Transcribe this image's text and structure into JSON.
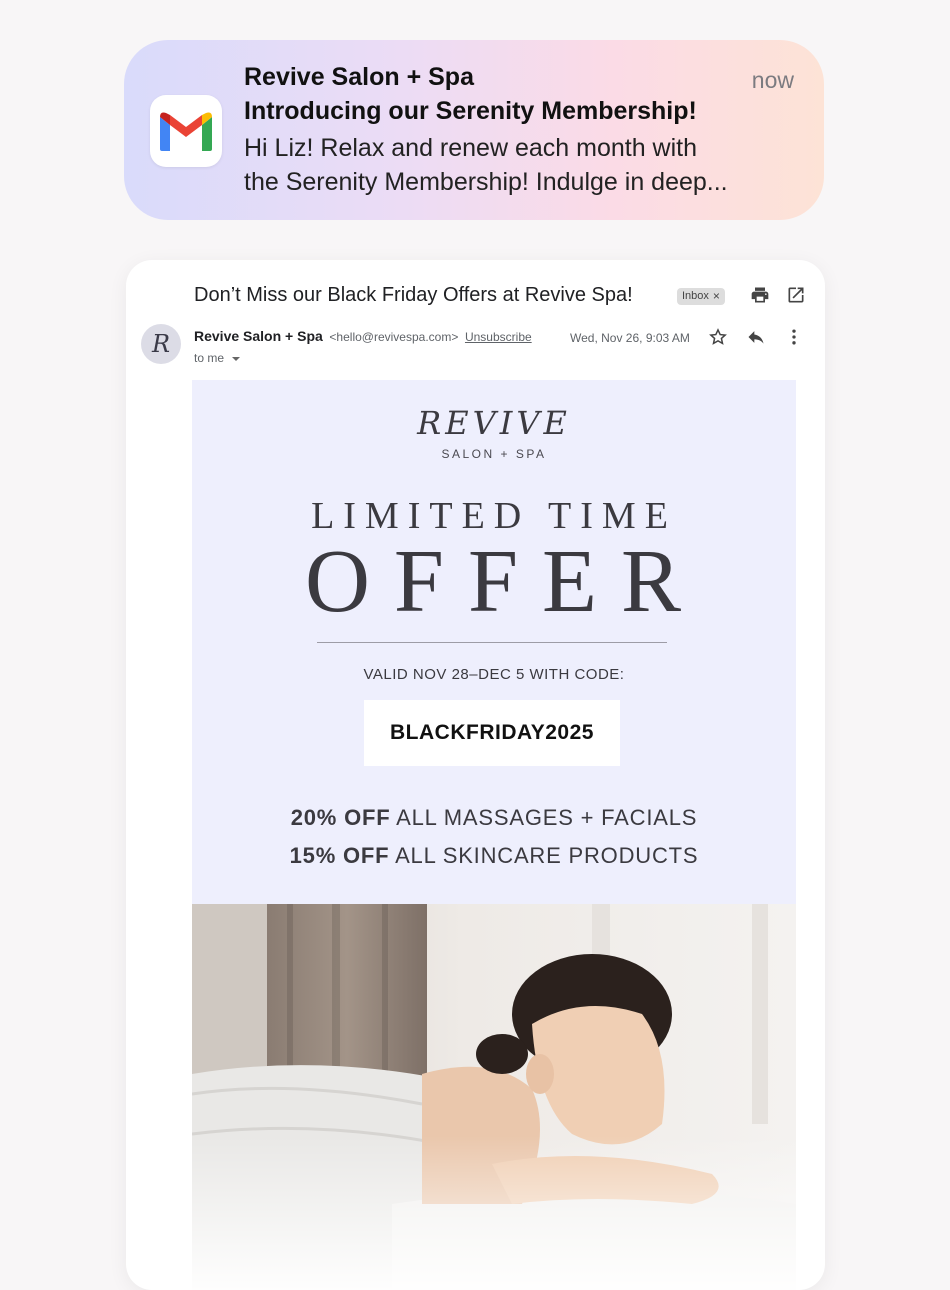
{
  "notification": {
    "app_icon": "gmail-icon",
    "sender": "Revive Salon + Spa",
    "subject": "Introducing our Serenity Membership!",
    "preview_line1": "Hi Liz! Relax and renew each month with",
    "preview_line2": "the Serenity Membership! Indulge in deep...",
    "time": "now"
  },
  "email": {
    "subject": "Don’t Miss our Black Friday Offers at Revive Spa!",
    "label": "Inbox",
    "label_close": "×",
    "avatar_letter": "R",
    "sender_name": "Revive Salon + Spa",
    "sender_email": "<hello@revivespa.com>",
    "unsubscribe": "Unsubscribe",
    "recipient": "to me",
    "date": "Wed, Nov 26, 9:03 AM"
  },
  "promo": {
    "brand": "REVIVE",
    "brand_sub": "SALON + SPA",
    "headline1": "LIMITED TIME",
    "headline2": "OFFER",
    "valid_text": "VALID NOV 28–DEC 5 WITH CODE:",
    "code": "BLACKFRIDAY2025",
    "deal1_bold": "20% OFF",
    "deal1_rest": " ALL MASSAGES + FACIALS",
    "deal2_bold": "15% OFF",
    "deal2_rest": " ALL SKINCARE PRODUCTS"
  },
  "colors": {
    "promo_bg": "#eeeffd",
    "text_dark": "#3b3a40",
    "gmail_red": "#ea4335",
    "gmail_blue": "#4285f4",
    "gmail_green": "#34a853",
    "gmail_yellow": "#fbbc04"
  }
}
